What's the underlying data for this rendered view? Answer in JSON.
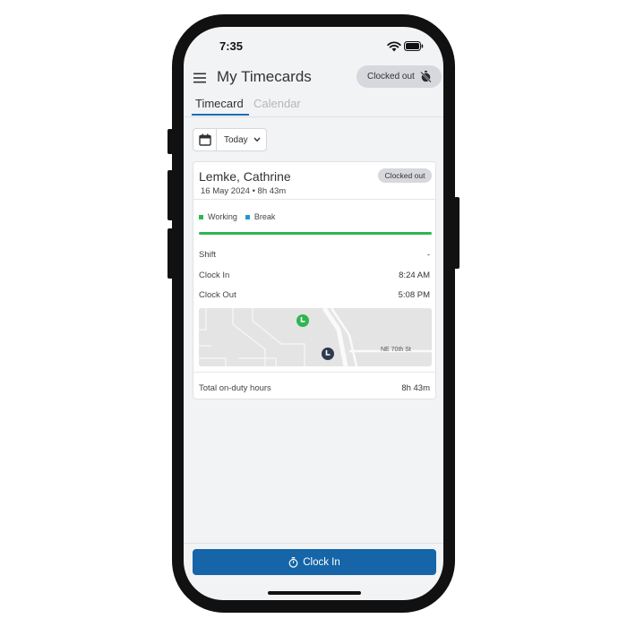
{
  "status_bar": {
    "time": "7:35"
  },
  "header": {
    "title": "My Timecards",
    "status_badge": "Clocked out"
  },
  "tabs": [
    {
      "label": "Timecard",
      "active": true
    },
    {
      "label": "Calendar",
      "active": false
    }
  ],
  "date_filter": {
    "selected": "Today"
  },
  "timecard": {
    "employee_name": "Lemke, Cathrine",
    "date_duration": "16 May 2024 • 8h 43m",
    "status_badge": "Clocked out",
    "legend": [
      {
        "label": "Working",
        "color": "#2fb550"
      },
      {
        "label": "Break",
        "color": "#1e9ad6"
      }
    ],
    "working_fraction": 1.0,
    "rows": [
      {
        "label": "Shift",
        "value": "-"
      },
      {
        "label": "Clock In",
        "value": "8:24 AM"
      },
      {
        "label": "Clock Out",
        "value": "5:08 PM"
      }
    ],
    "map": {
      "street_label": "NE 70th St"
    },
    "total_label": "Total on-duty hours",
    "total_value": "8h 43m"
  },
  "actions": {
    "clock_in_label": "Clock In"
  },
  "colors": {
    "accent": "#1565a8",
    "tab_indicator": "#1f6fb3",
    "clock_in_pin": "#2fb550",
    "clock_out_pin": "#2e3a4f"
  }
}
